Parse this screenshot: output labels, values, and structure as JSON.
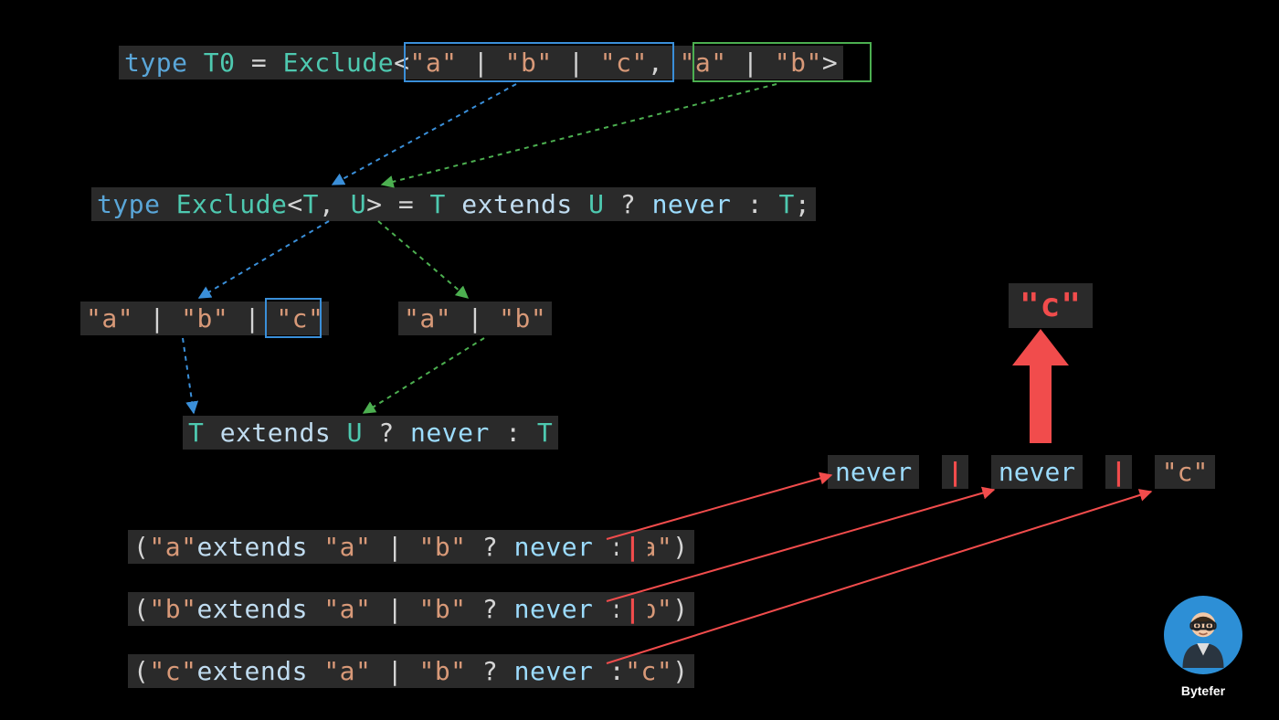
{
  "author": "Bytefer",
  "line1": {
    "kw": "type",
    "name": "T0",
    "eq": "=",
    "util": "Exclude",
    "lt": "<",
    "arg1_a": "\"a\"",
    "arg1_b": "\"b\"",
    "arg1_c": "\"c\"",
    "pipe": "|",
    "comma": ",",
    "arg2_a": "\"a\"",
    "arg2_b": "\"b\"",
    "gt": ">"
  },
  "line2": {
    "kw": "type",
    "name": "Exclude",
    "lt": "<",
    "T": "T",
    "comma": ",",
    "U": "U",
    "gt": ">",
    "eq": "=",
    "ext": "extends",
    "q": "?",
    "never": "never",
    "colon": ":",
    "semi": ";"
  },
  "line3_left": {
    "a": "\"a\"",
    "b": "\"b\"",
    "c": "\"c\"",
    "pipe": "|"
  },
  "line3_right": {
    "a": "\"a\"",
    "b": "\"b\"",
    "pipe": "|"
  },
  "line4": {
    "T": "T",
    "ext": "extends",
    "U": "U",
    "q": "?",
    "never": "never",
    "colon": ":",
    "T2": "T"
  },
  "result": {
    "c": "\"c\"",
    "never": "never",
    "pipe": "|",
    "c2": "\"c\""
  },
  "expand": [
    {
      "lp": "(",
      "v": "\"a\"",
      "ext": "extends",
      "a": "\"a\"",
      "pipe": "|",
      "b": "\"b\"",
      "q": "?",
      "never": "never",
      "colon": ":",
      "v2": "\"a\"",
      "rp": ")"
    },
    {
      "lp": "(",
      "v": "\"b\"",
      "ext": "extends",
      "a": "\"a\"",
      "pipe": "|",
      "b": "\"b\"",
      "q": "?",
      "never": "never",
      "colon": ":",
      "v2": "\"b\"",
      "rp": ")"
    },
    {
      "lp": "(",
      "v": "\"c\"",
      "ext": "extends",
      "a": "\"a\"",
      "pipe": "|",
      "b": "\"b\"",
      "q": "?",
      "never": "never",
      "colon": ":",
      "v2": "\"c\"",
      "rp": ")"
    }
  ],
  "red_pipe": "|"
}
